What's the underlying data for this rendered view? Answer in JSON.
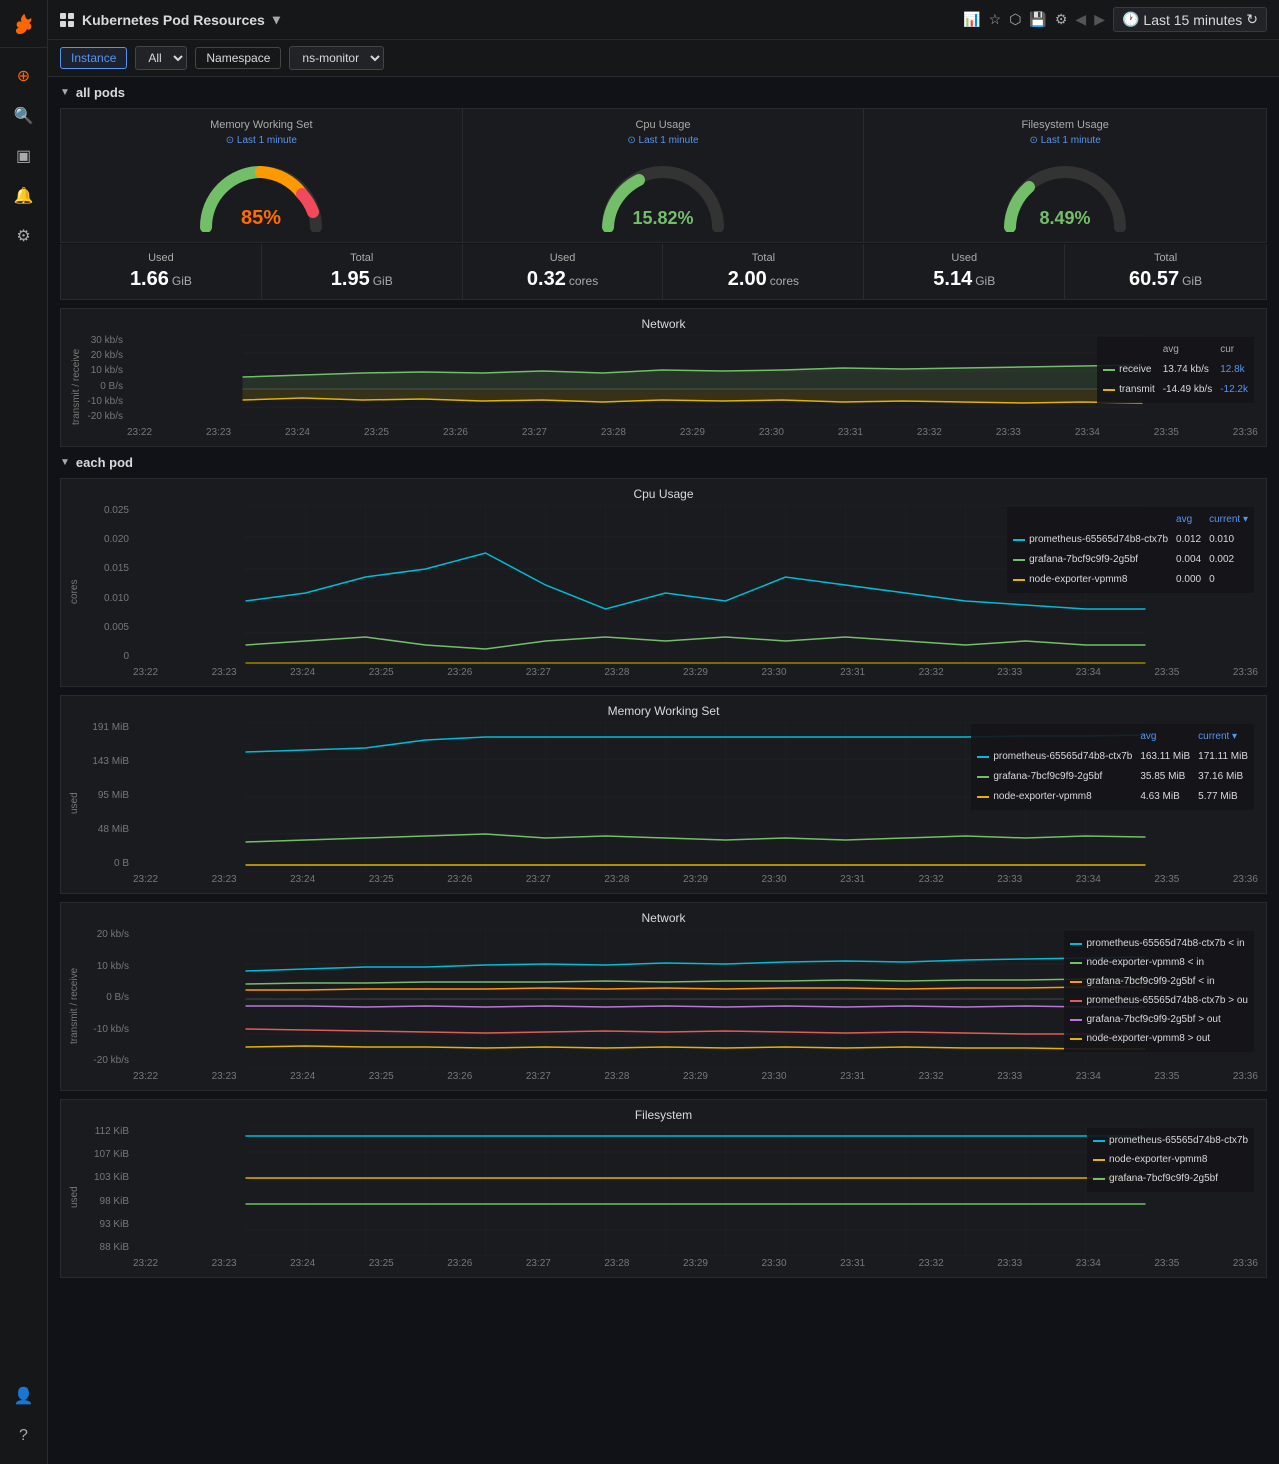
{
  "app": {
    "title": "Kubernetes Pod Resources",
    "logo_icon": "fire-icon"
  },
  "topbar": {
    "title": "Kubernetes Pod Resources",
    "time_label": "Last 15 minutes",
    "icons": [
      "chart-icon",
      "star-icon",
      "share-icon",
      "save-icon",
      "settings-icon",
      "prev-icon",
      "next-icon",
      "clock-icon",
      "refresh-icon"
    ]
  },
  "filterbar": {
    "instance_label": "Instance",
    "all_label": "All",
    "namespace_label": "Namespace",
    "ns_monitor_label": "ns-monitor"
  },
  "all_pods": {
    "section_label": "all pods",
    "memory_gauge": {
      "title": "Memory Working Set",
      "time": "Last 1 minute",
      "value": "85%",
      "color": "#ff6b00"
    },
    "cpu_gauge": {
      "title": "Cpu Usage",
      "time": "Last 1 minute",
      "value": "15.82%",
      "color": "#73bf69"
    },
    "fs_gauge": {
      "title": "Filesystem Usage",
      "time": "Last 1 minute",
      "value": "8.49%",
      "color": "#73bf69"
    },
    "stats": [
      {
        "label": "Used",
        "value": "1.66",
        "unit": "GiB"
      },
      {
        "label": "Total",
        "value": "1.95",
        "unit": "GiB"
      },
      {
        "label": "Used",
        "value": "0.32",
        "unit": "cores"
      },
      {
        "label": "Total",
        "value": "2.00",
        "unit": "cores"
      },
      {
        "label": "Used",
        "value": "5.14",
        "unit": "GiB"
      },
      {
        "label": "Total",
        "value": "60.57",
        "unit": "GiB"
      }
    ],
    "network": {
      "title": "Network",
      "yaxis": [
        "30 kb/s",
        "20 kb/s",
        "10 kb/s",
        "0 B/s",
        "-10 kb/s",
        "-20 kb/s"
      ],
      "xaxis": [
        "23:22",
        "23:23",
        "23:24",
        "23:25",
        "23:26",
        "23:27",
        "23:28",
        "23:29",
        "23:30",
        "23:31",
        "23:32",
        "23:33",
        "23:34",
        "23:35",
        "23:36"
      ],
      "legend": [
        {
          "label": "receive",
          "avg": "13.74 kb/s",
          "cur": "12.8k",
          "color": "#73bf69"
        },
        {
          "label": "transmit",
          "avg": "-14.49 kb/s",
          "cur": "-12.2k",
          "color": "#e0b400"
        }
      ]
    }
  },
  "each_pod": {
    "section_label": "each pod",
    "cpu_usage": {
      "title": "Cpu Usage",
      "yaxis": [
        "0.025",
        "0.020",
        "0.015",
        "0.010",
        "0.005",
        "0"
      ],
      "ylabel": "cores",
      "xaxis": [
        "23:22",
        "23:23",
        "23:24",
        "23:25",
        "23:26",
        "23:27",
        "23:28",
        "23:29",
        "23:30",
        "23:31",
        "23:32",
        "23:33",
        "23:34",
        "23:35",
        "23:36"
      ],
      "legend": [
        {
          "label": "prometheus-65565d74b8-ctx7b",
          "avg": "0.012",
          "current": "0.010",
          "color": "#00bcd4"
        },
        {
          "label": "grafana-7bcf9c9f9-2g5bf",
          "avg": "0.004",
          "current": "0.002",
          "color": "#73bf69"
        },
        {
          "label": "node-exporter-vpmm8",
          "avg": "0.000",
          "current": "0",
          "color": "#e0b400"
        }
      ]
    },
    "memory": {
      "title": "Memory Working Set",
      "yaxis": [
        "191 MiB",
        "143 MiB",
        "95 MiB",
        "48 MiB",
        "0 B"
      ],
      "ylabel": "used",
      "xaxis": [
        "23:22",
        "23:23",
        "23:24",
        "23:25",
        "23:26",
        "23:27",
        "23:28",
        "23:29",
        "23:30",
        "23:31",
        "23:32",
        "23:33",
        "23:34",
        "23:35",
        "23:36"
      ],
      "legend": [
        {
          "label": "prometheus-65565d74b8-ctx7b",
          "avg": "163.11 MiB",
          "current": "171.11 MiB",
          "color": "#00bcd4"
        },
        {
          "label": "grafana-7bcf9c9f9-2g5bf",
          "avg": "35.85 MiB",
          "current": "37.16 MiB",
          "color": "#73bf69"
        },
        {
          "label": "node-exporter-vpmm8",
          "avg": "4.63 MiB",
          "current": "5.77 MiB",
          "color": "#e0b400"
        }
      ]
    },
    "network": {
      "title": "Network",
      "yaxis": [
        "20 kb/s",
        "10 kb/s",
        "0 B/s",
        "-10 kb/s",
        "-20 kb/s"
      ],
      "ylabel": "transmit / receive",
      "xaxis": [
        "23:22",
        "23:23",
        "23:24",
        "23:25",
        "23:26",
        "23:27",
        "23:28",
        "23:29",
        "23:30",
        "23:31",
        "23:32",
        "23:33",
        "23:34",
        "23:35",
        "23:36"
      ],
      "legend": [
        {
          "label": "prometheus-65565d74b8-ctx7b < in",
          "color": "#00bcd4"
        },
        {
          "label": "node-exporter-vpmm8 < in",
          "color": "#73bf69"
        },
        {
          "label": "grafana-7bcf9c9f9-2g5bf < in",
          "color": "#ff9900"
        },
        {
          "label": "prometheus-65565d74b8-ctx7b > ou",
          "color": "#e05c5c"
        },
        {
          "label": "grafana-7bcf9c9f9-2g5bf > out",
          "color": "#b877d9"
        },
        {
          "label": "node-exporter-vpmm8 > out",
          "color": "#e0b400"
        }
      ]
    },
    "filesystem": {
      "title": "Filesystem",
      "yaxis": [
        "112 KiB",
        "107 KiB",
        "103 KiB",
        "98 KiB",
        "93 KiB",
        "88 KiB"
      ],
      "ylabel": "used",
      "xaxis": [
        "23:22",
        "23:23",
        "23:24",
        "23:25",
        "23:26",
        "23:27",
        "23:28",
        "23:29",
        "23:30",
        "23:31",
        "23:32",
        "23:33",
        "23:34",
        "23:35",
        "23:36"
      ],
      "legend": [
        {
          "label": "prometheus-65565d74b8-ctx7b",
          "color": "#00bcd4"
        },
        {
          "label": "node-exporter-vpmm8",
          "color": "#e0b400"
        },
        {
          "label": "grafana-7bcf9c9f9-2g5bf",
          "color": "#73bf69"
        }
      ]
    }
  }
}
